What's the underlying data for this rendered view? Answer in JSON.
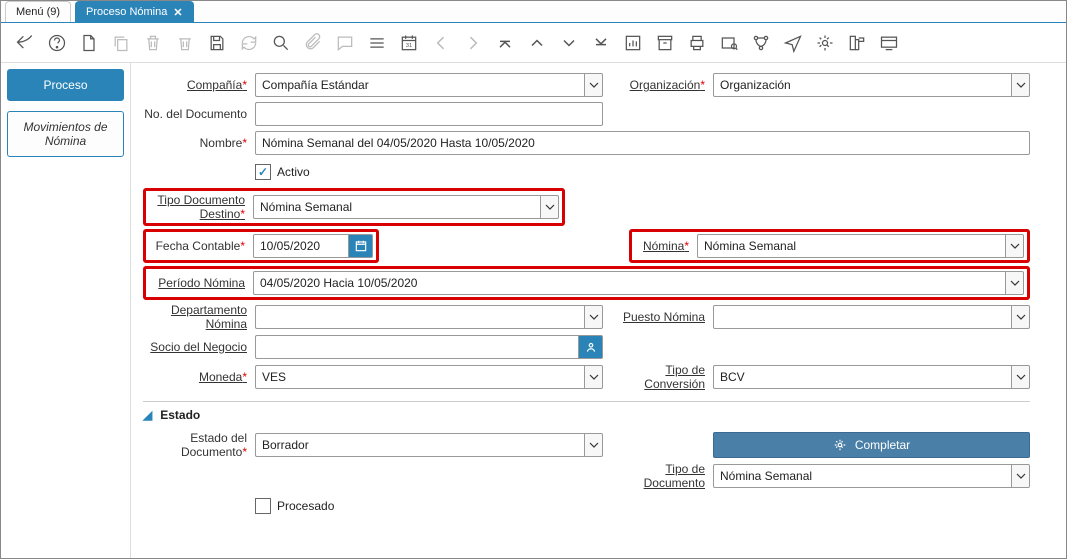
{
  "tabs": {
    "menu": "Menú (9)",
    "active": "Proceso Nómina"
  },
  "sidebar": {
    "proceso": "Proceso",
    "movimientos": "Movimientos de Nómina"
  },
  "labels": {
    "compania": "Compañía",
    "organizacion": "Organización",
    "no_doc": "No. del Documento",
    "nombre": "Nombre",
    "activo": "Activo",
    "tipo_doc_destino": "Tipo Documento Destino",
    "fecha_contable": "Fecha Contable",
    "nomina": "Nómina",
    "periodo_nomina": "Período Nómina",
    "departamento_nomina": "Departamento Nómina",
    "puesto_nomina": "Puesto Nómina",
    "socio_negocio": "Socio del Negocio",
    "moneda": "Moneda",
    "tipo_conversion": "Tipo de Conversión",
    "estado_section": "Estado",
    "estado_doc": "Estado del Documento",
    "tipo_doc": "Tipo de Documento",
    "procesado": "Procesado",
    "completar_btn": "Completar"
  },
  "values": {
    "compania": "Compañía Estándar",
    "organizacion": "Organización",
    "no_doc": "",
    "nombre": "Nómina Semanal del 04/05/2020 Hasta 10/05/2020",
    "activo_checked": true,
    "tipo_doc_destino": "Nómina Semanal",
    "fecha_contable": "10/05/2020",
    "nomina": "Nómina Semanal",
    "periodo_nomina": "04/05/2020 Hacia 10/05/2020",
    "departamento_nomina": "",
    "puesto_nomina": "",
    "socio_negocio": "",
    "moneda": "VES",
    "tipo_conversion": "BCV",
    "estado_doc": "Borrador",
    "tipo_doc": "Nómina Semanal",
    "procesado_checked": false
  }
}
